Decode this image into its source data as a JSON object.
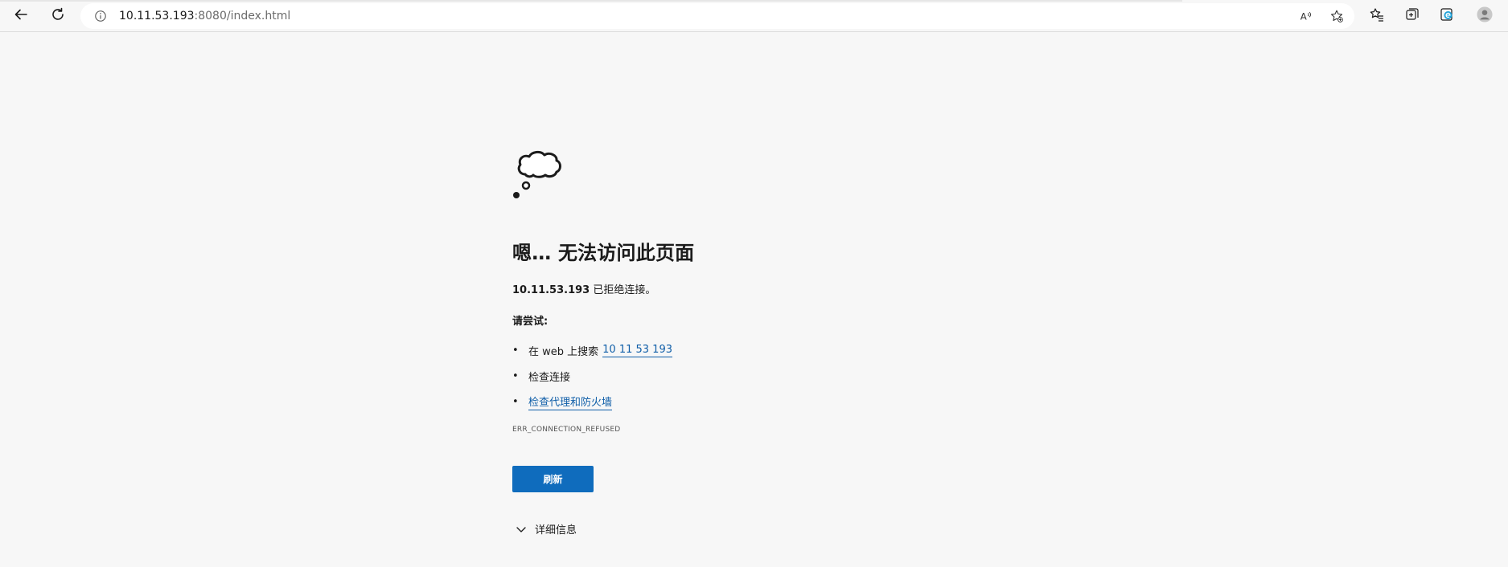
{
  "browser": {
    "address": {
      "host": "10.11.53.193",
      "path": ":8080/index.html"
    },
    "icons": {
      "back": "back-arrow-icon",
      "refresh": "refresh-icon",
      "info": "info-icon",
      "read_aloud": "read-aloud-icon",
      "add_favorite": "add-favorite-icon",
      "favorites": "favorites-icon",
      "collections": "collections-icon",
      "edge": "edge-icon",
      "profile": "profile-avatar-icon"
    },
    "read_aloud_label": "A⁾"
  },
  "error_page": {
    "title": "嗯… 无法访问此页面",
    "host": "10.11.53.193",
    "refused_suffix": "已拒绝连接。",
    "try_label": "请尝试:",
    "suggestions": {
      "search_prefix": "在 web 上搜索",
      "search_link": "10 11 53 193",
      "check_connection": "检查连接",
      "check_proxy": "检查代理和防火墙"
    },
    "error_code": "ERR_CONNECTION_REFUSED",
    "refresh_button": "刷新",
    "details_label": "详细信息"
  },
  "colors": {
    "accent": "#0f6cbd",
    "link": "#0f5ea8",
    "background": "#f7f7f7"
  }
}
